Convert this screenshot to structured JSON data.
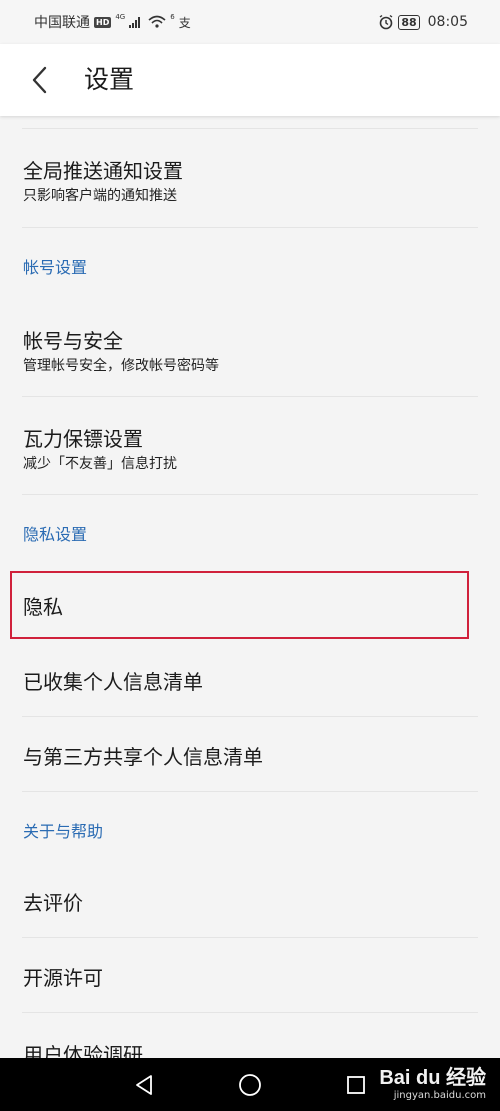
{
  "status_bar": {
    "carrier": "中国联通",
    "hd_badge": "HD",
    "network": "4G",
    "wifi_sub": "6",
    "extra_icon_glyph": "支",
    "battery": "88",
    "time": "08:05"
  },
  "header": {
    "title": "设置",
    "back_icon": "chevron-left-icon"
  },
  "items": {
    "push": {
      "title": "全局推送通知设置",
      "subtitle": "只影响客户端的通知推送"
    },
    "account_security": {
      "title": "帐号与安全",
      "subtitle": "管理帐号安全，修改帐号密码等"
    },
    "wali": {
      "title": "瓦力保镖设置",
      "subtitle": "减少「不友善」信息打扰"
    },
    "privacy": {
      "title": "隐私"
    },
    "collected_info": {
      "title": "已收集个人信息清单"
    },
    "third_party": {
      "title": "与第三方共享个人信息清单"
    },
    "rate": {
      "title": "去评价"
    },
    "open_source": {
      "title": "开源许可"
    },
    "ux_survey": {
      "title": "用户体验调研"
    }
  },
  "sections": {
    "account": "帐号设置",
    "privacy": "隐私设置",
    "about": "关于与帮助"
  },
  "watermark": {
    "logo": "Bai du 经验",
    "url": "jingyan.baidu.com"
  },
  "colors": {
    "section_header": "#2a6bb3",
    "highlight_border": "#d0213b",
    "background": "#f4f4f4"
  }
}
